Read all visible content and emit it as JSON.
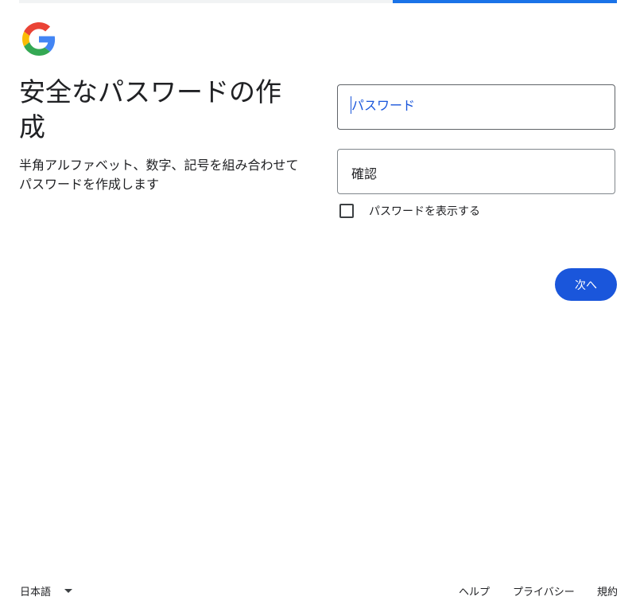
{
  "progress": {
    "value": 0.375
  },
  "brand": {
    "logo_icon": "google-g-icon",
    "colors": [
      "#4285F4",
      "#EA4335",
      "#FBBC05",
      "#34A853"
    ]
  },
  "heading": "安全なパスワードの作成",
  "description": "半角アルファベット、数字、記号を組み合わせてパスワードを作成します",
  "fields": {
    "password": {
      "label": "パスワード",
      "value": ""
    },
    "confirm": {
      "label": "確認",
      "value": ""
    }
  },
  "show_password": {
    "label": "パスワードを表示する",
    "checked": false
  },
  "next_button": {
    "label": "次へ",
    "color": "#1a56db"
  },
  "footer": {
    "language": "日本語",
    "links": {
      "help": "ヘルプ",
      "privacy": "プライバシー",
      "terms": "規約"
    }
  }
}
